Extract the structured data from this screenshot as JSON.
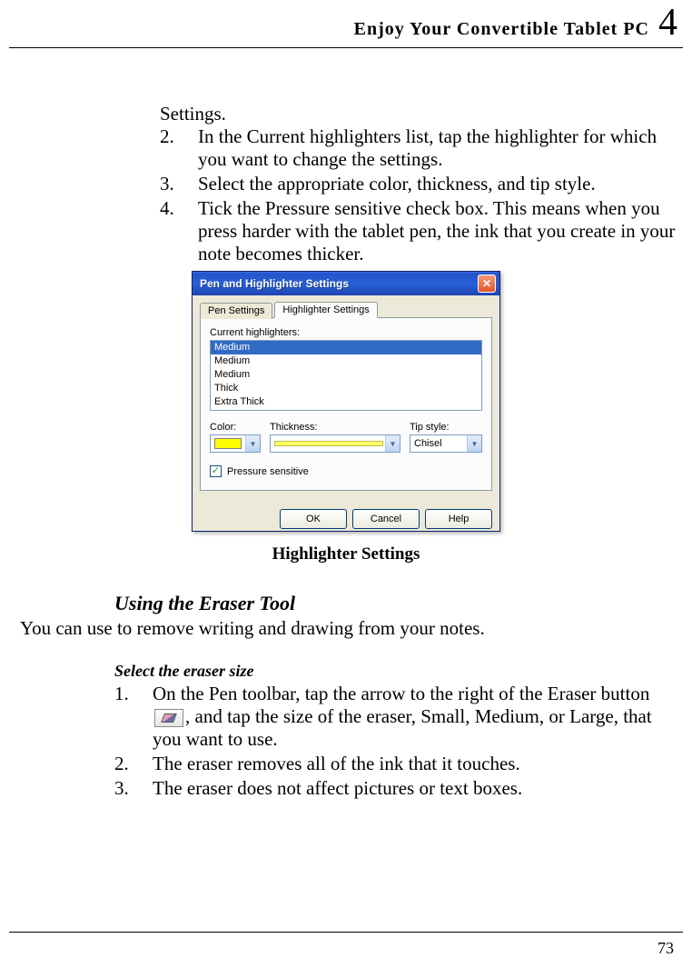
{
  "header": {
    "title": "Enjoy Your Convertible Tablet PC",
    "chapter": "4"
  },
  "intro_continued": "Settings.",
  "steps_top": [
    {
      "n": "2.",
      "t": "In the Current highlighters list, tap the highlighter for which you want to change the settings."
    },
    {
      "n": "3.",
      "t": "Select the appropriate color, thickness, and tip style."
    },
    {
      "n": "4.",
      "t": "Tick the Pressure sensitive check box. This means when you press harder with the tablet pen, the ink that you create in your note becomes thicker."
    }
  ],
  "dialog": {
    "title": "Pen and Highlighter Settings",
    "tabs": {
      "inactive": "Pen Settings",
      "active": "Highlighter Settings"
    },
    "list_label": "Current highlighters:",
    "list": [
      "Medium",
      "Medium",
      "Medium",
      "Thick",
      "Extra Thick"
    ],
    "color_label": "Color:",
    "thick_label": "Thickness:",
    "tip_label": "Tip style:",
    "tip_value": "Chisel",
    "pressure": "Pressure sensitive",
    "ok": "OK",
    "cancel": "Cancel",
    "help": "Help"
  },
  "caption": "Highlighter Settings",
  "eraser_head": "Using the Eraser Tool",
  "eraser_intro": "You can use to remove writing and drawing from your notes.",
  "eraser_subhead": "Select the eraser size",
  "steps_eraser": [
    {
      "n": "1.",
      "pre": "On the Pen toolbar, tap the arrow to the right of the Eraser button ",
      "post": ", and tap the size of the eraser, Small, Medium, or Large, that you want to use."
    },
    {
      "n": "2.",
      "t": "The eraser removes all of the ink that it touches."
    },
    {
      "n": "3.",
      "t": "The eraser does not affect pictures or text boxes."
    }
  ],
  "page": "73"
}
